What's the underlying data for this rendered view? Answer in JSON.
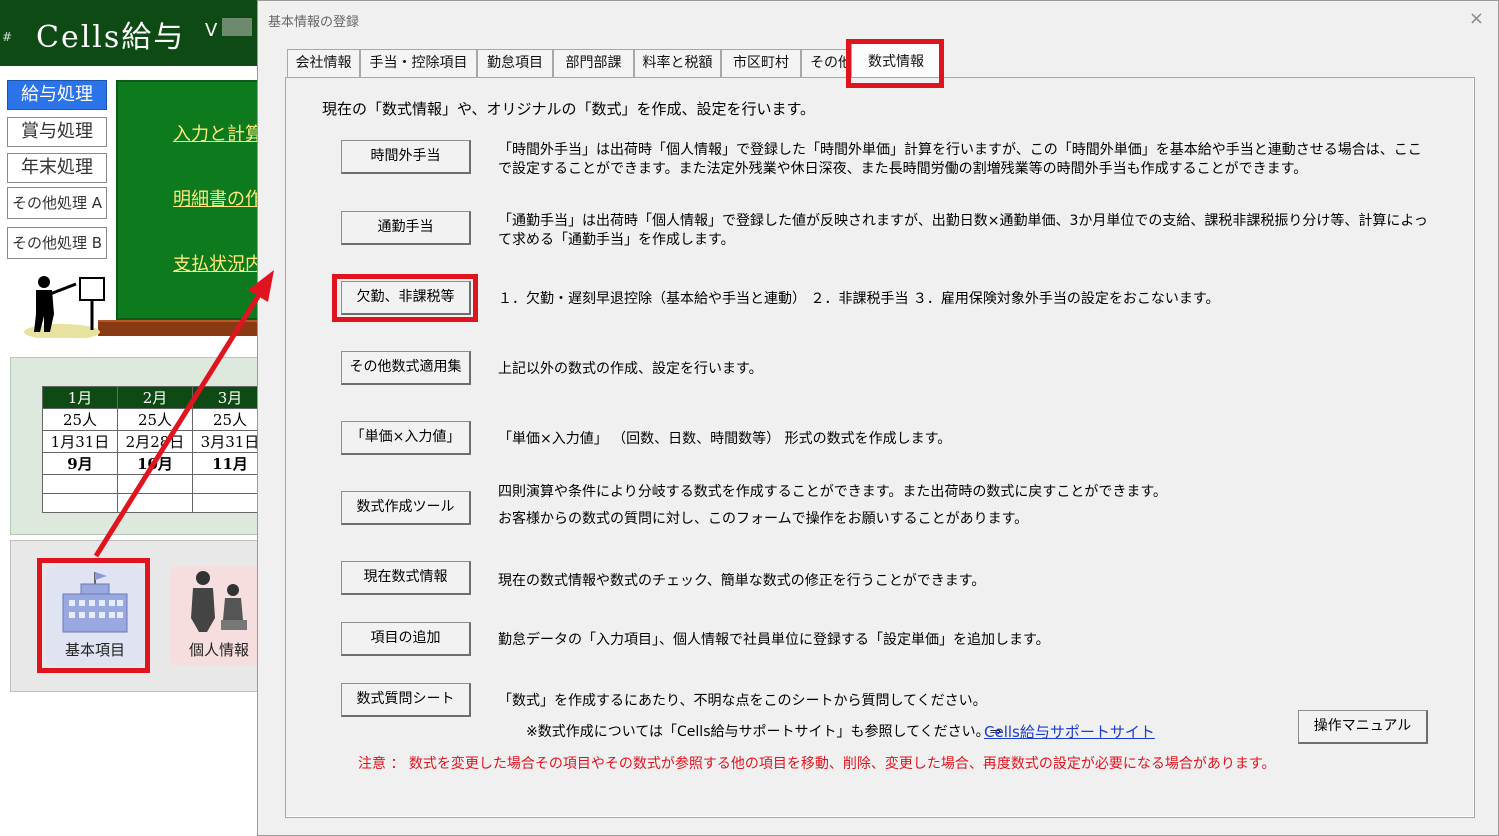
{
  "app": {
    "hash": "#",
    "title": "Cells給与",
    "version_prefix": "V",
    "side_menu": [
      "給与処理",
      "賞与処理",
      "年末処理",
      "その他処理 A",
      "その他処理 B"
    ],
    "board_links": [
      "入力と計算",
      "明細書の作成",
      "支払状況内"
    ],
    "calendar": {
      "months_top": [
        "1月",
        "2月",
        "3月"
      ],
      "counts": [
        "25人",
        "25人",
        "25人"
      ],
      "dates": [
        "1月31日",
        "2月28日",
        "3月31日"
      ],
      "months_bottom": [
        "9月",
        "10月",
        "11月"
      ]
    },
    "tiles": {
      "basic": "基本項目",
      "personal": "個人情報"
    }
  },
  "dialog": {
    "title": "基本情報の登録",
    "close": "×",
    "tabs": [
      "会社情報",
      "手当・控除項目",
      "勤怠項目",
      "部門部課",
      "料率と税額",
      "市区町村",
      "その他",
      "数式情報"
    ],
    "intro": "現在の「数式情報」や、オリジナルの「数式」を作成、設定を行います。",
    "rows": [
      {
        "button": "時間外手当",
        "desc": "「時間外手当」は出荷時「個人情報」で登録した「時間外単価」計算を行いますが、この「時間外単価」を基本給や手当と連動させる場合は、ここで設定することができます。また法定外残業や休日深夜、また長時間労働の割増残業等の時間外手当も作成することができます。"
      },
      {
        "button": "通勤手当",
        "desc": "「通勤手当」は出荷時「個人情報」で登録した値が反映されますが、出勤日数×通勤単価、3か月単位での支給、課税非課税振り分け等、計算によって求める「通勤手当」を作成します。"
      },
      {
        "button": "欠勤、非課税等",
        "desc": "１．欠勤・遅刻早退控除（基本給や手当と連動） ２．非課税手当 ３．雇用保険対象外手当の設定をおこないます。"
      },
      {
        "button": "その他数式適用集",
        "desc": "上記以外の数式の作成、設定を行います。"
      },
      {
        "button": "「単価×入力値」",
        "desc": "「単価×入力値」 （回数、日数、時間数等） 形式の数式を作成します。"
      },
      {
        "button": "数式作成ツール",
        "desc": "四則演算や条件により分岐する数式を作成することができます。また出荷時の数式に戻すことができます。",
        "desc2": "お客様からの数式の質問に対し、このフォームで操作をお願いすることがあります。"
      },
      {
        "button": "現在数式情報",
        "desc": "現在の数式情報や数式のチェック、簡単な数式の修正を行うことができます。"
      },
      {
        "button": "項目の追加",
        "desc": "勤怠データの「入力項目」、個人情報で社員単位に登録する「設定単価」を追加します。"
      },
      {
        "button": "数式質問シート",
        "desc": "「数式」を作成するにあたり、不明な点をこのシートから質問してください。"
      }
    ],
    "support_note": "※数式作成については「Cells給与サポートサイト」も参照してください。⇒",
    "support_link": "Cells給与サポートサイト",
    "manual_button": "操作マニュアル",
    "caution": "注意 ： 数式を変更した場合その項目やその数式が参照する他の項目を移動、削除、変更した場合、再度数式の設定が必要になる場合があります。"
  },
  "colors": {
    "header_green": "#0e4a14",
    "board_green": "#0d7a1e",
    "highlight_red": "#e0141e",
    "link_blue": "#1a3ccf"
  }
}
